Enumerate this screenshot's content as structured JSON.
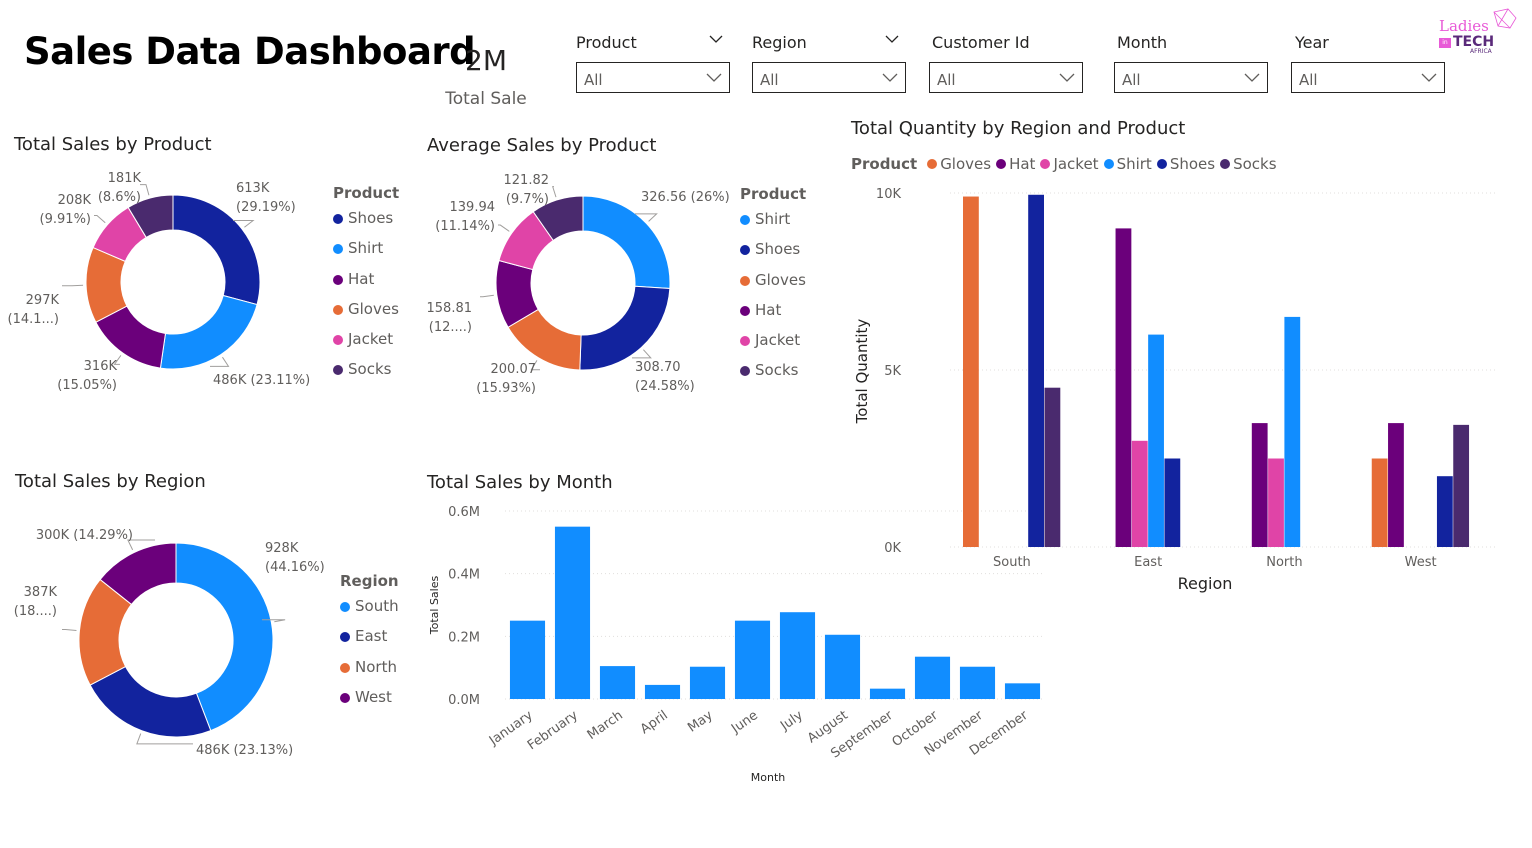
{
  "dashboard": {
    "title": "Sales Data Dashboard",
    "kpi": {
      "value": "2M",
      "label": "Total Sale"
    }
  },
  "slicers": [
    {
      "label": "Product",
      "value": "All"
    },
    {
      "label": "Region",
      "value": "All"
    },
    {
      "label": "Customer Id",
      "value": "All"
    },
    {
      "label": "Month",
      "value": "All"
    },
    {
      "label": "Year",
      "value": "All"
    }
  ],
  "logo": {
    "line1": "Ladies",
    "badge": "in",
    "line2": "TECH",
    "line3": "AFRICA"
  },
  "colors": {
    "Shoes": "#12239e",
    "Shirt": "#118dff",
    "Hat": "#6b007b",
    "Gloves": "#e66c37",
    "Jacket": "#e044a7",
    "Socks": "#4a2a6e",
    "South": "#118dff",
    "East": "#12239e",
    "North": "#e66c37",
    "West": "#6b007b",
    "bar": "#118dff"
  },
  "chart_data": [
    {
      "id": "sales_by_product",
      "type": "pie",
      "title": "Total Sales by Product",
      "legend_title": "Product",
      "legend_position": "right",
      "categories": [
        "Shoes",
        "Shirt",
        "Hat",
        "Gloves",
        "Jacket",
        "Socks"
      ],
      "values": [
        613,
        486,
        316,
        297,
        208,
        181
      ],
      "percents": [
        29.19,
        23.11,
        15.05,
        14.1,
        9.91,
        8.6
      ],
      "data_labels": [
        [
          "613K",
          "(29.19%)"
        ],
        [
          "486K (23.11%)"
        ],
        [
          "316K",
          "(15.05%)"
        ],
        [
          "297K",
          "(14.1...)"
        ],
        [
          "208K",
          "(9.91%)"
        ],
        [
          "181K",
          "(8.6%)"
        ]
      ]
    },
    {
      "id": "avg_sales_by_product",
      "type": "pie",
      "title": "Average Sales by Product",
      "legend_title": "Product",
      "legend_position": "right",
      "categories": [
        "Shirt",
        "Shoes",
        "Gloves",
        "Hat",
        "Jacket",
        "Socks"
      ],
      "values": [
        326.56,
        308.7,
        200.07,
        158.81,
        139.94,
        121.82
      ],
      "percents": [
        26,
        24.58,
        15.93,
        12.64,
        11.14,
        9.7
      ],
      "data_labels": [
        [
          "326.56 (26%)"
        ],
        [
          "308.70",
          "(24.58%)"
        ],
        [
          "200.07",
          "(15.93%)"
        ],
        [
          "158.81",
          "(12....)"
        ],
        [
          "139.94",
          "(11.14%)"
        ],
        [
          "121.82",
          "(9.7%)"
        ]
      ]
    },
    {
      "id": "sales_by_region",
      "type": "pie",
      "title": "Total Sales by Region",
      "legend_title": "Region",
      "legend_position": "right",
      "categories": [
        "South",
        "East",
        "North",
        "West"
      ],
      "values": [
        928,
        486,
        387,
        300
      ],
      "percents": [
        44.16,
        23.13,
        18.42,
        14.29
      ],
      "data_labels": [
        [
          "928K",
          "(44.16%)"
        ],
        [
          "486K (23.13%)"
        ],
        [
          "387K",
          "(18....)"
        ],
        [
          "300K (14.29%)"
        ]
      ]
    },
    {
      "id": "sales_by_month",
      "type": "bar",
      "title": "Total Sales by Month",
      "xlabel": "Month",
      "ylabel": "Total Sales",
      "categories": [
        "January",
        "February",
        "March",
        "April",
        "May",
        "June",
        "July",
        "August",
        "September",
        "October",
        "November",
        "December"
      ],
      "values": [
        0.25,
        0.55,
        0.105,
        0.045,
        0.103,
        0.25,
        0.277,
        0.205,
        0.033,
        0.135,
        0.103,
        0.05
      ],
      "value_unit": "M",
      "ylim": [
        0,
        0.6
      ],
      "yticks": [
        "0.0M",
        "0.2M",
        "0.4M",
        "0.6M"
      ],
      "grid": true
    },
    {
      "id": "qty_by_region_product",
      "type": "bar",
      "title": "Total Quantity by Region and Product",
      "legend_title": "Product",
      "legend_position": "top",
      "xlabel": "Region",
      "ylabel": "Total Quantity",
      "categories": [
        "South",
        "East",
        "North",
        "West"
      ],
      "series": [
        {
          "name": "Gloves",
          "values": [
            9900,
            0,
            0,
            2500
          ]
        },
        {
          "name": "Hat",
          "values": [
            0,
            9000,
            3500,
            3500
          ]
        },
        {
          "name": "Jacket",
          "values": [
            0,
            3000,
            2500,
            0
          ]
        },
        {
          "name": "Shirt",
          "values": [
            0,
            6000,
            6500,
            0
          ]
        },
        {
          "name": "Shoes",
          "values": [
            9950,
            2500,
            0,
            2000
          ]
        },
        {
          "name": "Socks",
          "values": [
            4500,
            0,
            0,
            3450
          ]
        }
      ],
      "ylim": [
        0,
        10000
      ],
      "yticks": [
        "0K",
        "5K",
        "10K"
      ],
      "grid": true
    }
  ]
}
